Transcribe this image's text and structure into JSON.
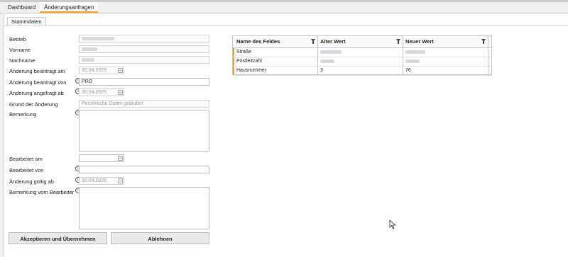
{
  "tabs": {
    "dashboard": "Dashboard",
    "aenderungsanfragen": "Änderungsanfragen"
  },
  "subtab": {
    "stammdaten": "Stammdaten"
  },
  "form": {
    "betrieb_label": "Betrieb",
    "vorname_label": "Vorname",
    "nachname_label": "Nachname",
    "aenderung_beantragt_am_label": "Änderung beantragt am",
    "aenderung_beantragt_am_value": "30.04.2025",
    "aenderung_beantragt_von_label": "Änderung beantragt von",
    "aenderung_beantragt_von_value": "PRO",
    "aenderung_angefragt_ab_label": "Änderung angefragt ab",
    "aenderung_angefragt_ab_value": "30.04.2025",
    "grund_label": "Grund der Änderung",
    "grund_value": "Persönliche Daten geändert",
    "bemerkung_label": "Bemerkung",
    "bearbeitet_am_label": "Bearbeitet am",
    "bearbeitet_von_label": "Bearbeitet von",
    "aenderung_gueltig_ab_label": "Änderung gültig ab",
    "aenderung_gueltig_ab_value": "30.04.2025",
    "bemerkung_bearbeiter_label": "Bemerkung vom Bearbeiter"
  },
  "buttons": {
    "accept": "Akzeptieren und Übernehmen",
    "reject": "Ablehnen"
  },
  "grid": {
    "headers": [
      "Name des Feldes",
      "Alter Wert",
      "Neuer Wert"
    ],
    "rows": [
      {
        "field": "Straße",
        "old": "",
        "new": ""
      },
      {
        "field": "Postleitzahl",
        "old": "",
        "new": ""
      },
      {
        "field": "Hausnummer",
        "old": "3",
        "new": "76"
      }
    ]
  },
  "icons": {
    "info": "info-icon",
    "calendar": "calendar-icon",
    "filter": "filter-icon",
    "cursor": "mouse-pointer-icon"
  },
  "colors": {
    "accent": "#e8a13a",
    "background": "#f0f0f0"
  }
}
